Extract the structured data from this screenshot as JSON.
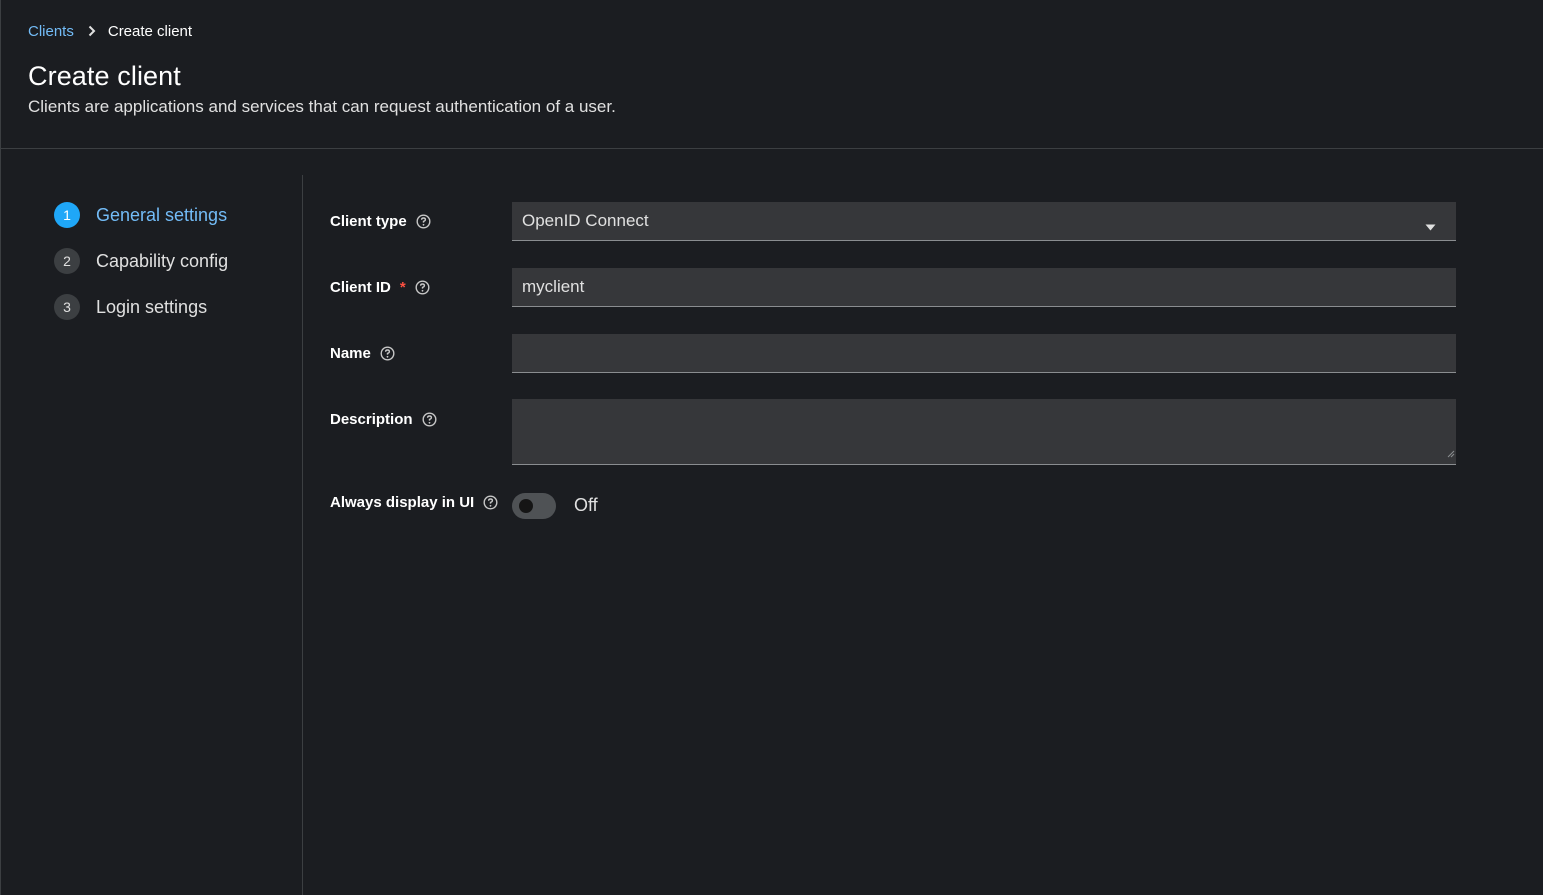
{
  "breadcrumb": {
    "parent": "Clients",
    "current": "Create client"
  },
  "header": {
    "title": "Create client",
    "subtitle": "Clients are applications and services that can request authentication of a user."
  },
  "wizard": {
    "steps": [
      {
        "number": "1",
        "label": "General settings",
        "active": true
      },
      {
        "number": "2",
        "label": "Capability config",
        "active": false
      },
      {
        "number": "3",
        "label": "Login settings",
        "active": false
      }
    ]
  },
  "form": {
    "client_type": {
      "label": "Client type",
      "value": "OpenID Connect"
    },
    "client_id": {
      "label": "Client ID",
      "required_mark": "*",
      "value": "myclient"
    },
    "name": {
      "label": "Name",
      "value": ""
    },
    "description": {
      "label": "Description",
      "value": ""
    },
    "always_display": {
      "label": "Always display in UI",
      "state_label": "Off",
      "on": false
    }
  },
  "icons": {
    "breadcrumb_separator": "chevron-right-icon",
    "help": "help-circle-icon",
    "dropdown": "caret-down-icon"
  },
  "colors": {
    "accent": "#73bcf7",
    "active_step": "#1fa7f8",
    "required": "#fe5142",
    "background": "#1b1d21"
  }
}
